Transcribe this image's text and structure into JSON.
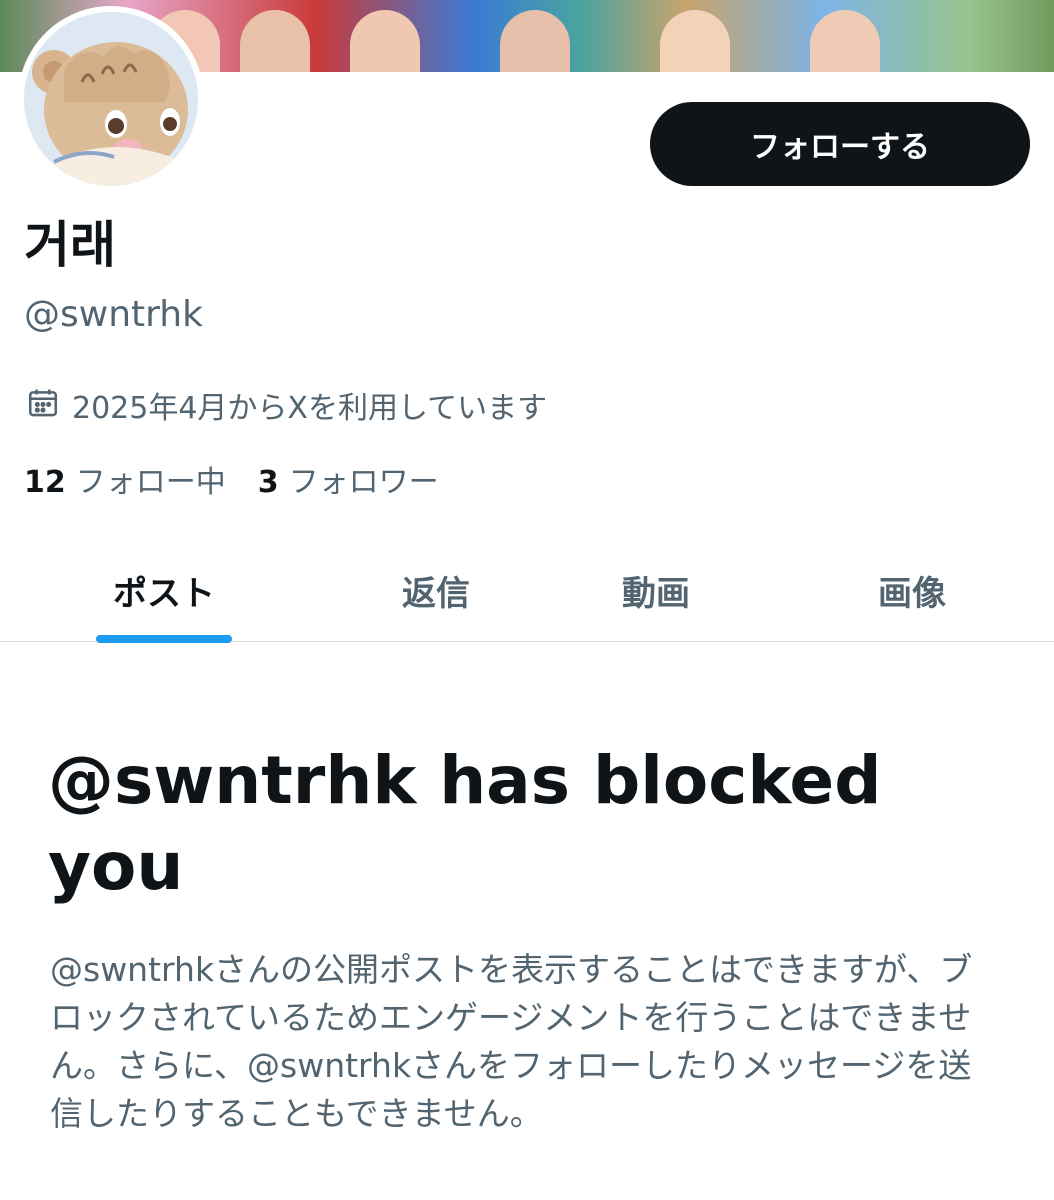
{
  "profile": {
    "display_name": "거래",
    "handle": "@swntrhk",
    "joined": "2025年4月からXを利用しています"
  },
  "actions": {
    "follow_label": "フォローする"
  },
  "stats": {
    "following_count": "12",
    "following_label": "フォロー中",
    "followers_count": "3",
    "followers_label": "フォロワー"
  },
  "tabs": [
    {
      "label": "ポスト",
      "active": true
    },
    {
      "label": "返信",
      "active": false
    },
    {
      "label": "動画",
      "active": false
    },
    {
      "label": "画像",
      "active": false
    }
  ],
  "blocked": {
    "title": "@swntrhk has blocked you",
    "description": "@swntrhkさんの公開ポストを表示することはできますが、ブロックされているためエンゲージメントを行うことはできません。さらに、@swntrhkさんをフォローしたりメッセージを送信したりすることもできません。"
  },
  "colors": {
    "accent": "#1d9bf0",
    "button_bg": "#0f1419",
    "secondary_text": "#536471"
  },
  "icons": {
    "calendar": "calendar-icon"
  }
}
